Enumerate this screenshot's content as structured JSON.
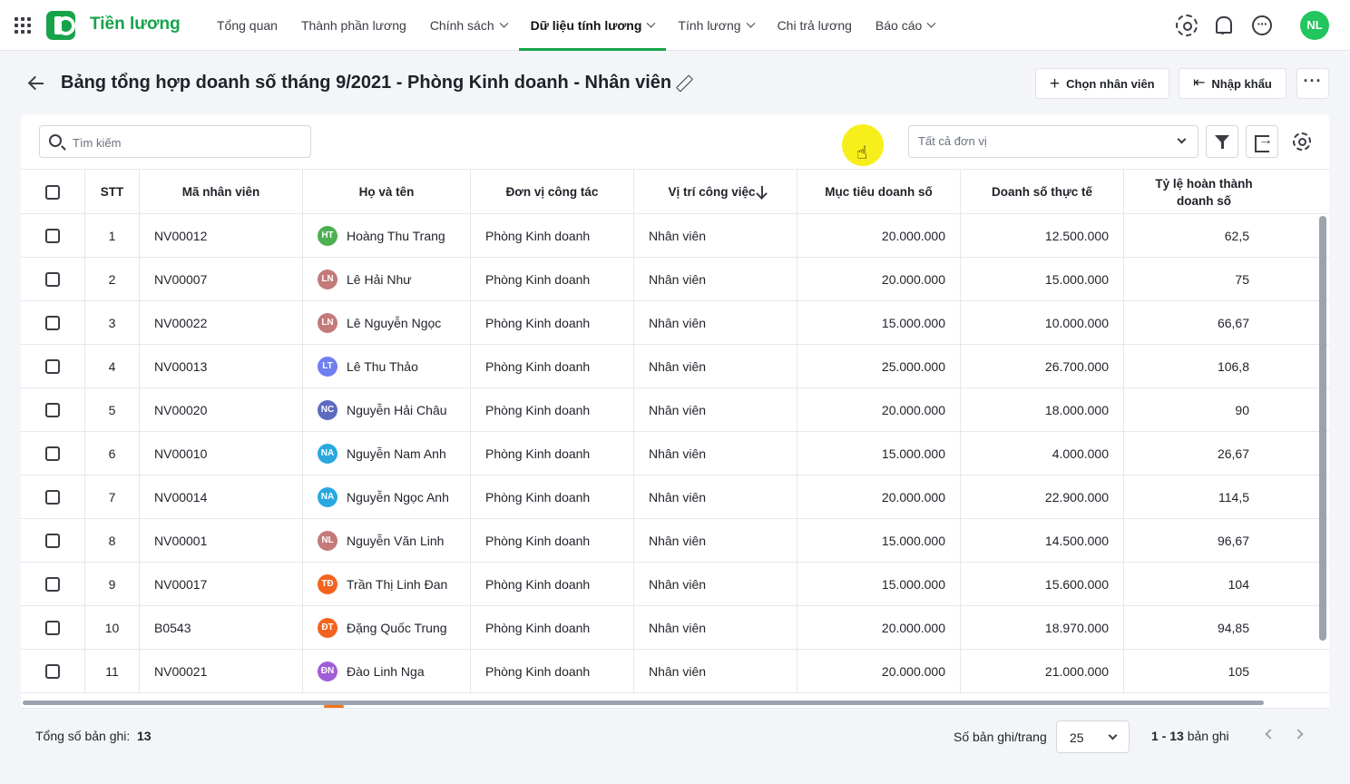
{
  "app": {
    "brand": "Tiền lương",
    "user_initials": "NL"
  },
  "nav": [
    {
      "label": "Tổng quan",
      "dropdown": false,
      "active": false
    },
    {
      "label": "Thành phần lương",
      "dropdown": false,
      "active": false
    },
    {
      "label": "Chính sách",
      "dropdown": true,
      "active": false
    },
    {
      "label": "Dữ liệu tính lương",
      "dropdown": true,
      "active": true
    },
    {
      "label": "Tính lương",
      "dropdown": true,
      "active": false
    },
    {
      "label": "Chi trả lương",
      "dropdown": false,
      "active": false
    },
    {
      "label": "Báo cáo",
      "dropdown": true,
      "active": false
    }
  ],
  "header": {
    "title": "Bảng tổng hợp doanh số tháng 9/2021 - Phòng Kinh doanh - Nhân viên",
    "choose_employee": "Chọn nhân viên",
    "import": "Nhập khẩu"
  },
  "toolbar": {
    "search_placeholder": "Tìm kiếm",
    "unit_select": "Tất cả đơn vị"
  },
  "table": {
    "columns": {
      "stt": "STT",
      "code": "Mã nhân viên",
      "name": "Họ và tên",
      "unit": "Đơn vị công tác",
      "position": "Vị trí công việc",
      "target": "Mục tiêu doanh số",
      "actual": "Doanh số thực tế",
      "ratio_l1": "Tỷ lệ hoàn thành",
      "ratio_l2": "doanh số"
    },
    "rows": [
      {
        "stt": "1",
        "code": "NV00012",
        "initials": "HT",
        "color": "#4caf50",
        "name": "Hoàng Thu Trang",
        "unit": "Phòng Kinh doanh",
        "position": "Nhân viên",
        "target": "20.000.000",
        "actual": "12.500.000",
        "ratio": "62,5"
      },
      {
        "stt": "2",
        "code": "NV00007",
        "initials": "LN",
        "color": "#c47a7a",
        "name": "Lê Hải Như",
        "unit": "Phòng Kinh doanh",
        "position": "Nhân viên",
        "target": "20.000.000",
        "actual": "15.000.000",
        "ratio": "75"
      },
      {
        "stt": "3",
        "code": "NV00022",
        "initials": "LN",
        "color": "#c47a7a",
        "name": "Lê Nguyễn Ngọc",
        "unit": "Phòng Kinh doanh",
        "position": "Nhân viên",
        "target": "15.000.000",
        "actual": "10.000.000",
        "ratio": "66,67"
      },
      {
        "stt": "4",
        "code": "NV00013",
        "initials": "LT",
        "color": "#6f7ef0",
        "name": "Lê Thu Thảo",
        "unit": "Phòng Kinh doanh",
        "position": "Nhân viên",
        "target": "25.000.000",
        "actual": "26.700.000",
        "ratio": "106,8"
      },
      {
        "stt": "5",
        "code": "NV00020",
        "initials": "NC",
        "color": "#5c6bc0",
        "name": "Nguyễn Hải Châu",
        "unit": "Phòng Kinh doanh",
        "position": "Nhân viên",
        "target": "20.000.000",
        "actual": "18.000.000",
        "ratio": "90"
      },
      {
        "stt": "6",
        "code": "NV00010",
        "initials": "NA",
        "color": "#29a8e0",
        "name": "Nguyễn Nam Anh",
        "unit": "Phòng Kinh doanh",
        "position": "Nhân viên",
        "target": "15.000.000",
        "actual": "4.000.000",
        "ratio": "26,67"
      },
      {
        "stt": "7",
        "code": "NV00014",
        "initials": "NA",
        "color": "#29a8e0",
        "name": "Nguyễn Ngọc Anh",
        "unit": "Phòng Kinh doanh",
        "position": "Nhân viên",
        "target": "20.000.000",
        "actual": "22.900.000",
        "ratio": "114,5"
      },
      {
        "stt": "8",
        "code": "NV00001",
        "initials": "NL",
        "color": "#c47a7a",
        "name": "Nguyễn Văn Linh",
        "unit": "Phòng Kinh doanh",
        "position": "Nhân viên",
        "target": "15.000.000",
        "actual": "14.500.000",
        "ratio": "96,67"
      },
      {
        "stt": "9",
        "code": "NV00017",
        "initials": "TĐ",
        "color": "#f4631e",
        "name": "Trần Thị Linh Đan",
        "unit": "Phòng Kinh doanh",
        "position": "Nhân viên",
        "target": "15.000.000",
        "actual": "15.600.000",
        "ratio": "104"
      },
      {
        "stt": "10",
        "code": "B0543",
        "initials": "ĐT",
        "color": "#f4631e",
        "name": "Đặng Quốc Trung",
        "unit": "Phòng Kinh doanh",
        "position": "Nhân viên",
        "target": "20.000.000",
        "actual": "18.970.000",
        "ratio": "94,85"
      },
      {
        "stt": "11",
        "code": "NV00021",
        "initials": "ĐN",
        "color": "#a05ed6",
        "name": "Đào Linh Nga",
        "unit": "Phòng Kinh doanh",
        "position": "Nhân viên",
        "target": "20.000.000",
        "actual": "21.000.000",
        "ratio": "105"
      }
    ]
  },
  "footer": {
    "total_label": "Tổng số bản ghi:",
    "total_value": "13",
    "per_page_label": "Số bản ghi/trang",
    "per_page_value": "25",
    "range_bold": "1 - 13",
    "range_suffix": "bản ghi"
  }
}
